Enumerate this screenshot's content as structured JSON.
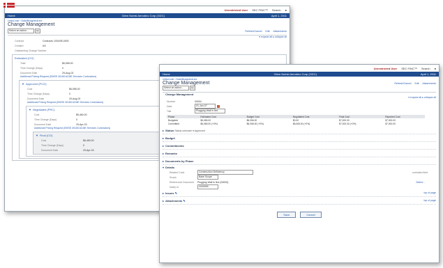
{
  "topbar": {
    "user": "Unrestricted User",
    "tools": "SEC FINC™",
    "search": "Search"
  },
  "back": {
    "header_left": "Home",
    "header_center": "Glem Nutrisi Aerodino Corp (GDC)",
    "header_right": "April 1, 2011",
    "breadcrumb": "UnitsCode › Data/BudgetedLine",
    "page_title": "Change Management",
    "select_value": "Select an action...",
    "go": "Go",
    "links": [
      "Refresh/Cancel",
      "Edit",
      "Attachments"
    ],
    "right_links": "▾ expand all   ▸ collapse all",
    "fields": [
      {
        "k": "Contract",
        "v": "Contracts 1004/05-0000"
      },
      {
        "k": "Created",
        "v": "AS"
      },
      {
        "k": "Outstanding Change Number",
        "v": ""
      }
    ],
    "box1_title": "Estimated (CO)",
    "box1_fields": [
      {
        "k": "Total",
        "v": "$6,065.00"
      },
      {
        "k": "Time Change (Days)",
        "v": "0"
      },
      {
        "k": "Document Date",
        "v": "29-Aug-02"
      }
    ],
    "box1_link": "Additional Pricing Request (EMSS 30165 ACME Services Contractors)",
    "box2_title": "Approved (PCO)",
    "box2_fields": [
      {
        "k": "Cost",
        "v": "$6,056.00"
      },
      {
        "k": "Time Change (Days)",
        "v": "0"
      },
      {
        "k": "Document Date",
        "v": "29-Aug-02"
      }
    ],
    "box2_link": "Additional Pricing Request (EMSS 30165 ACME Services Contractors)",
    "box3_title": "Negotiated (PRC)",
    "box3_fields": [
      {
        "k": "Cost",
        "v": "$5,460.00"
      },
      {
        "k": "Time Change (Days)",
        "v": "0"
      },
      {
        "k": "Document Date",
        "v": "29-Apr-03"
      }
    ],
    "box3_link": "Additional Pricing Request (EMSS 30165 ACME Services Contractors)",
    "box4_title": "Final (CO)",
    "box4_fields": [
      {
        "k": "Cost",
        "v": "$6,450.00"
      },
      {
        "k": "Time Change (Days)",
        "v": "0"
      },
      {
        "k": "Document Date",
        "v": "29-Apr-03"
      }
    ]
  },
  "front": {
    "header_left": "Home",
    "header_center": "Glem Nutrisi Aerodino Corp (GDC)",
    "header_right": "April 1, 2011",
    "breadcrumb": "UnitsCode › Data/BudgetedLine",
    "page_title": "Change Management",
    "select_value": "Select an action...",
    "go": "Go",
    "links": [
      "Refresh/Cancel",
      "Edit",
      "Attachments"
    ],
    "right_links": "▾ expand all   ▸ collapse all",
    "cm_title": "Change Management",
    "fields": [
      {
        "k": "Number",
        "v": "00004"
      },
      {
        "k": "Date",
        "v": "01-Jan-07"
      },
      {
        "k": "Title",
        "v": "Plugging Wall in line"
      }
    ],
    "table_headers": [
      "Phase",
      "Estimated Cost",
      "Budget Cost",
      "Negotiated Cost",
      "Final Cost",
      "Reported Cost"
    ],
    "table_rows": [
      [
        "Budgeted",
        "$6,065.00",
        "$6,056.00",
        "$0.00",
        "$7,000.00",
        "$7,000.00"
      ],
      [
        "Committed",
        "$6,065.00 (+0%)",
        "$6,056.00 (+0%)",
        "$6,065.00 (+0%)",
        "$7,000.00 (+0%)",
        "$7,000.00"
      ]
    ],
    "status_label": "Status",
    "status_text": "Status unknown  ▾  Approved",
    "sections": [
      "Budget",
      "Commitments",
      "Remarks",
      "Documents by Phase"
    ],
    "details_title": "Details",
    "details_fields": [
      {
        "k": "Related Code",
        "v": "Construction Deficiency"
      },
      {
        "k": "Scope",
        "v": "Base Scope"
      },
      {
        "k": "Referenced Document",
        "v": "Plugging Wall in line (00003)"
      },
      {
        "k": "Notify Id",
        "v": "0009999"
      }
    ],
    "details_right": "  unrelated field",
    "details_link": "Select...",
    "issues_label": "Issues",
    "attachments_label": "Attachments",
    "top_of_page": "top of page",
    "save": "Save",
    "cancel": "Cancel"
  }
}
